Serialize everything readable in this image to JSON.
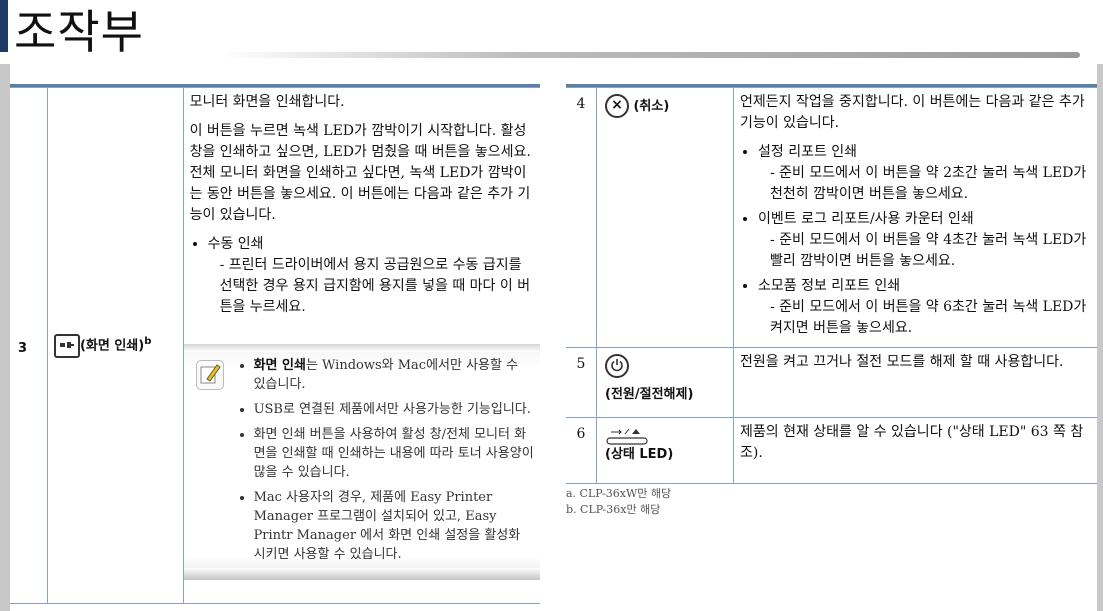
{
  "header": {
    "title": "조작부"
  },
  "left_row": {
    "number": "3",
    "name": "(화면 인쇄)",
    "name_sup": "b",
    "icon": "print-screen-icon",
    "desc_p1": "모니터 화면을 인쇄합니다.",
    "desc_p2": "이 버튼을 누르면 녹색 LED가 깜박이기 시작합니다. 활성 창을 인쇄하고 싶으면, LED가 멈췄을 때 버튼을 놓으세요. 전체 모니터 화면을 인쇄하고 싶다면, 녹색 LED가 깜박이는 동안 버튼을 놓으세요. 이 버튼에는 다음과 같은 추가 기능이 있습니다.",
    "bullet1_title": "수동 인쇄",
    "bullet1_sub": "- 프린터 드라이버에서 용지 공급원으로 수동 급지를 선택한 경우 용지 급지함에 용지를 넣을 때 마다 이 버튼을 누르세요.",
    "note": {
      "icon": "note-pencil-icon",
      "item1_bold": "화면 인쇄",
      "item1_rest": "는 Windows와 Mac에서만 사용할 수 있습니다.",
      "item2": "USB로 연결된 제품에서만 사용가능한 기능입니다.",
      "item3": "화면 인쇄 버튼을 사용하여 활성 창/전체 모니터 화면을 인쇄할 때 인쇄하는 내용에 따라 토너 사용양이 많을 수 있습니다.",
      "item4": "Mac 사용자의 경우, 제품에 Easy Printer Manager 프로그램이 설치되어 있고, Easy Printr Manager 에서 화면 인쇄 설정을 활성화 시키면 사용할 수 있습니다."
    }
  },
  "right_rows": [
    {
      "number": "4",
      "icon": "cancel-icon",
      "name": "(취소)",
      "desc": "언제든지 작업을 중지합니다. 이 버튼에는 다음과 같은 추가 기능이 있습니다.",
      "bullets": [
        {
          "title": "설정 리포트 인쇄",
          "sub": "- 준비 모드에서 이 버튼을 약 2초간 눌러 녹색 LED가 천천히 깜박이면 버튼을 놓으세요."
        },
        {
          "title": "이벤트 로그 리포트/사용 카운터 인쇄",
          "sub": "- 준비 모드에서 이 버튼을 약 4초간 눌러 녹색 LED가 빨리 깜박이면 버튼을 놓으세요."
        },
        {
          "title": "소모품 정보 리포트 인쇄",
          "sub": "- 준비 모드에서 이 버튼을 약 6초간 눌러 녹색 LED가 켜지면 버튼을 놓으세요."
        }
      ]
    },
    {
      "number": "5",
      "icon": "power-icon",
      "name": "(전원/절전해제)",
      "desc": "전원을 켜고 끄거나 절전 모드를 해제 할 때 사용합니다."
    },
    {
      "number": "6",
      "icon": "status-led-icon",
      "name": "(상태 LED)",
      "desc": "제품의 현재 상태를 알 수 있습니다 (\"상태 LED\" 63 쪽 참조)."
    }
  ],
  "footnotes": [
    "a. CLP-36xW만 해당",
    "b. CLP-36x만 해당"
  ]
}
